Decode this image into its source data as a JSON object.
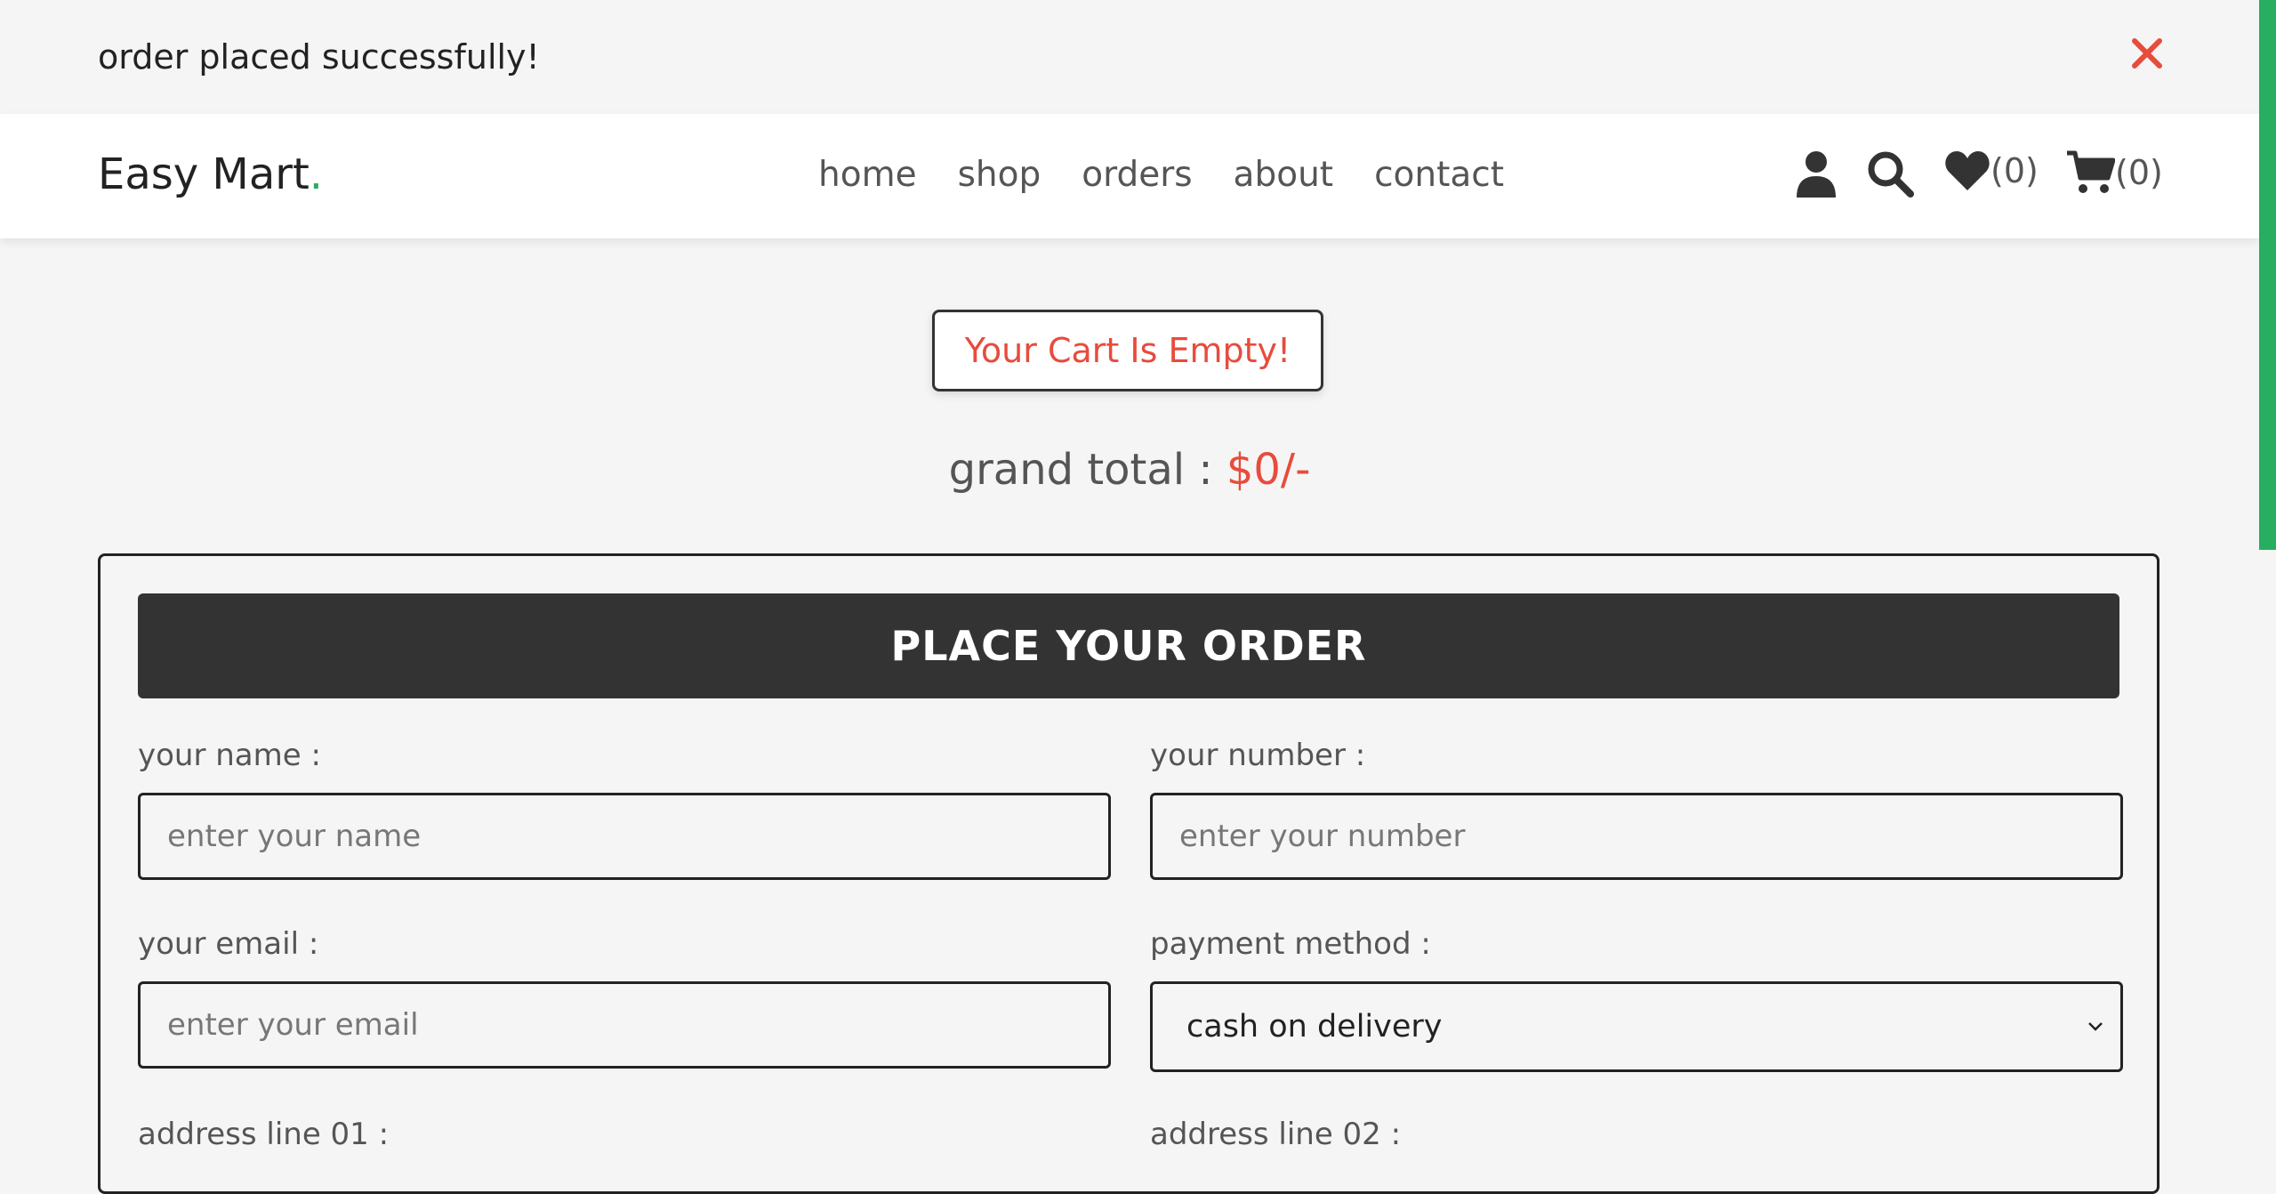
{
  "message": {
    "text": "order placed successfully!",
    "close_icon": "close-icon",
    "close_color": "#e74c3c"
  },
  "header": {
    "logo_text": "Easy Mart",
    "logo_dot": ".",
    "accent_color": "#27ae60",
    "nav": [
      "home",
      "shop",
      "orders",
      "about",
      "contact"
    ],
    "wishlist_count": "(0)",
    "cart_count": "(0)",
    "icons": [
      "user-icon",
      "search-icon",
      "heart-icon",
      "cart-icon"
    ]
  },
  "cart": {
    "empty_message": "Your Cart Is Empty!",
    "grand_total_label": "grand total :",
    "grand_total_value": "$0/-"
  },
  "form": {
    "title": "PLACE YOUR ORDER",
    "name_label": "your name :",
    "name_placeholder": "enter your name",
    "number_label": "your number :",
    "number_placeholder": "enter your number",
    "email_label": "your email :",
    "email_placeholder": "enter your email",
    "payment_label": "payment method :",
    "payment_value": "cash on delivery",
    "address1_label": "address line 01 :",
    "address2_label": "address line 02 :"
  }
}
